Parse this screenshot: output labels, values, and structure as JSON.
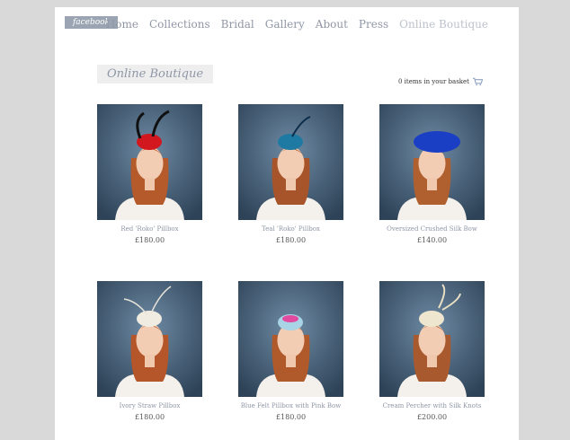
{
  "facebook_label": "facebook",
  "nav": [
    {
      "label": "Home"
    },
    {
      "label": "Collections"
    },
    {
      "label": "Bridal"
    },
    {
      "label": "Gallery"
    },
    {
      "label": "About"
    },
    {
      "label": "Press"
    },
    {
      "label": "Online Boutique"
    }
  ],
  "page_title": "Online Boutique",
  "basket_text": "0 items in your basket",
  "products": [
    {
      "name": "Red 'Roko' Pillbox",
      "price": "£180.00",
      "hat_color": "#d3171f",
      "hair_color": "#b55a2b"
    },
    {
      "name": "Teal 'Roko' Pillbox",
      "price": "£180.00",
      "hat_color": "#1e7aa3",
      "hair_color": "#a8542a"
    },
    {
      "name": "Oversized Crushed Silk Bow",
      "price": "£140.00",
      "hat_color": "#1a3fc4",
      "hair_color": "#b0602f"
    },
    {
      "name": "Ivory Straw Pillbox",
      "price": "£180.00",
      "hat_color": "#f0ece2",
      "hair_color": "#b5562a"
    },
    {
      "name": "Blue Felt Pillbox with Pink Bow",
      "price": "£180.00",
      "hat_color": "#a8d4e6",
      "hair_color": "#b05a2c"
    },
    {
      "name": "Cream Percher with Silk Knots",
      "price": "£200.00",
      "hat_color": "#efe6cf",
      "hair_color": "#a85a2e"
    }
  ]
}
